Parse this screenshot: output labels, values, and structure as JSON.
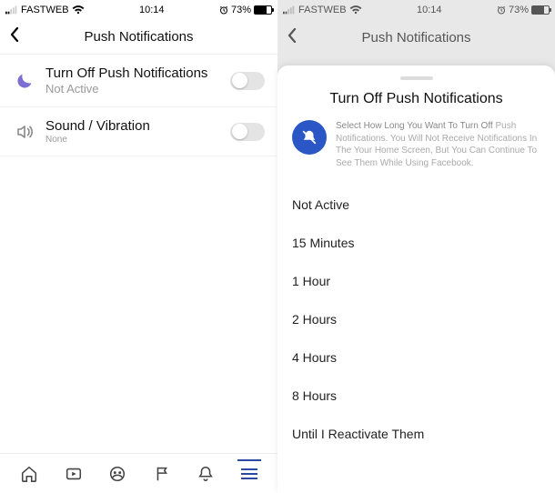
{
  "status": {
    "carrier": "FASTWEB",
    "time": "10:14",
    "battery_pct": "73%",
    "battery_level": 73
  },
  "left": {
    "header": {
      "title": "Push Notifications"
    },
    "rows": {
      "mute": {
        "title": "Turn Off Push Notifications",
        "sub": "Not Active"
      },
      "sound": {
        "title": "Sound / Vibration",
        "sub": "None"
      }
    }
  },
  "right": {
    "header": {
      "title": "Push Notifications"
    },
    "modal": {
      "title": "Turn Off Push Notifications",
      "desc_lead": "Select How Long You Want To Turn Off",
      "desc_rest": "Push Notifications. You Will Not Receive Notifications In The Your Home Screen, But You Can Continue To See Them While Using Facebook.",
      "options": [
        "Not Active",
        "15 Minutes",
        "1 Hour",
        "2 Hours",
        "4 Hours",
        "8 Hours",
        "Until I Reactivate Them"
      ]
    }
  },
  "colors": {
    "accent": "#2a56c6",
    "moon": "#7b6fd4"
  }
}
